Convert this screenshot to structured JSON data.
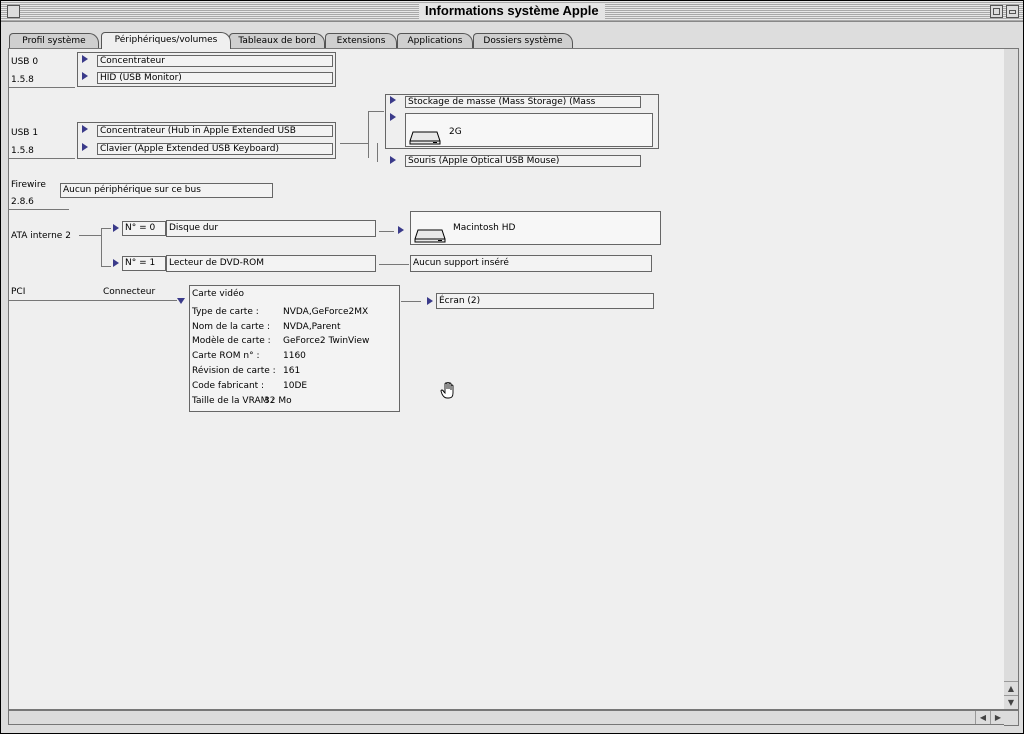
{
  "window": {
    "title": "Informations système Apple"
  },
  "tabs": [
    {
      "label": "Profil système"
    },
    {
      "label": "Périphériques/volumes",
      "active": true
    },
    {
      "label": "Tableaux de bord"
    },
    {
      "label": "Extensions"
    },
    {
      "label": "Applications"
    },
    {
      "label": "Dossiers système"
    }
  ],
  "usb0": {
    "name": "USB 0",
    "version": "1.5.8",
    "devices": [
      "Concentrateur",
      "HID (USB Monitor)"
    ]
  },
  "usb1": {
    "name": "USB 1",
    "version": "1.5.8",
    "devices": [
      "Concentrateur (Hub in Apple Extended USB",
      "Clavier (Apple Extended USB Keyboard)"
    ],
    "hub_children": {
      "storage": "Stockage de masse (Mass Storage) (Mass",
      "volume": "2G",
      "mouse": "Souris (Apple Optical USB Mouse)"
    }
  },
  "firewire": {
    "name": "Firewire",
    "version": "2.8.6",
    "status": "Aucun périphérique sur ce bus"
  },
  "ata": {
    "name": "ATA interne 2",
    "devices": [
      {
        "id": "N° = 0",
        "type": "Disque dur",
        "result": "Macintosh HD"
      },
      {
        "id": "N° = 1",
        "type": "Lecteur de DVD-ROM",
        "result": "Aucun support inséré"
      }
    ]
  },
  "pci": {
    "name": "PCI",
    "slot": "Connecteur",
    "card": {
      "title": "Carte vidéo",
      "rows": [
        {
          "label": "Type de carte :",
          "value": "NVDA,GeForce2MX"
        },
        {
          "label": "Nom de la carte :",
          "value": "NVDA,Parent"
        },
        {
          "label": "Modèle de carte :",
          "value": "GeForce2 TwinView"
        },
        {
          "label": "Carte ROM n° :",
          "value": "1160"
        },
        {
          "label": "Révision de carte :",
          "value": "161"
        },
        {
          "label": "Code fabricant :",
          "value": "10DE"
        },
        {
          "label": "Taille de la VRAM :",
          "value": "32 Mo"
        }
      ]
    },
    "display": "Écran (2)"
  }
}
